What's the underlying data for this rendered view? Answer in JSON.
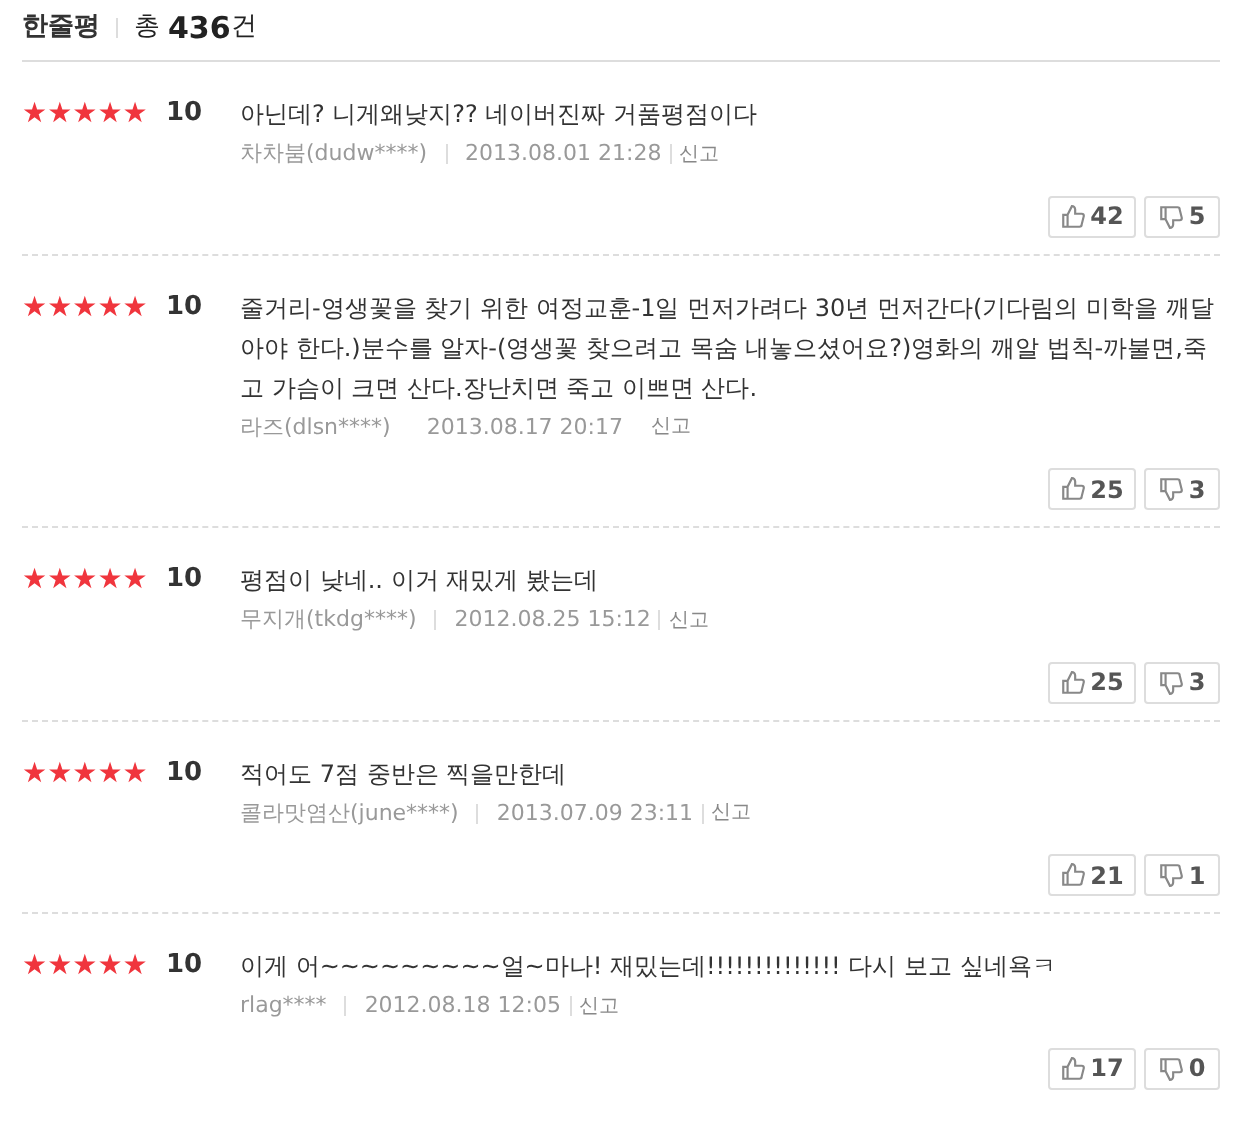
{
  "header": {
    "title": "한줄평",
    "total_prefix": "총",
    "total_count": "436",
    "total_suffix": "건"
  },
  "reviews": [
    {
      "stars": 5,
      "score": "10",
      "text": "아닌데? 니게왜낮지?? 네이버진짜 거품평점이다",
      "author": "차차붐(dudw****)",
      "date": "2013.08.01 21:28",
      "report": "신고",
      "separated": true,
      "likes": "42",
      "dislikes": "5"
    },
    {
      "stars": 5,
      "score": "10",
      "text": "줄거리-영생꽃을 찾기 위한 여정교훈-1일 먼저가려다 30년 먼저간다(기다림의 미학을 깨달아야 한다.)분수를 알자-(영생꽃 찾으려고 목숨 내놓으셨어요?)영화의 깨알 법칙-까불면,죽고 가슴이 크면 산다.장난치면 죽고 이쁘면 산다.",
      "author": "라즈(dlsn****)",
      "date": "2013.08.17 20:17",
      "report": "신고",
      "separated": false,
      "likes": "25",
      "dislikes": "3"
    },
    {
      "stars": 5,
      "score": "10",
      "text": "평점이 낮네.. 이거 재밌게 봤는데",
      "author": "무지개(tkdg****)",
      "date": "2012.08.25 15:12",
      "report": "신고",
      "separated": true,
      "likes": "25",
      "dislikes": "3"
    },
    {
      "stars": 5,
      "score": "10",
      "text": "적어도 7점 중반은 찍을만한데",
      "author": "콜라맛염산(june****)",
      "date": "2013.07.09 23:11",
      "report": "신고",
      "separated": true,
      "likes": "21",
      "dislikes": "1"
    },
    {
      "stars": 5,
      "score": "10",
      "text": "이게 어~~~~~~~~~얼~마나! 재밌는데!!!!!!!!!!!!!! 다시 보고 싶네욕ㅋ",
      "author": "rlag****",
      "date": "2012.08.18 12:05",
      "report": "신고",
      "separated": true,
      "likes": "17",
      "dislikes": "0"
    }
  ]
}
